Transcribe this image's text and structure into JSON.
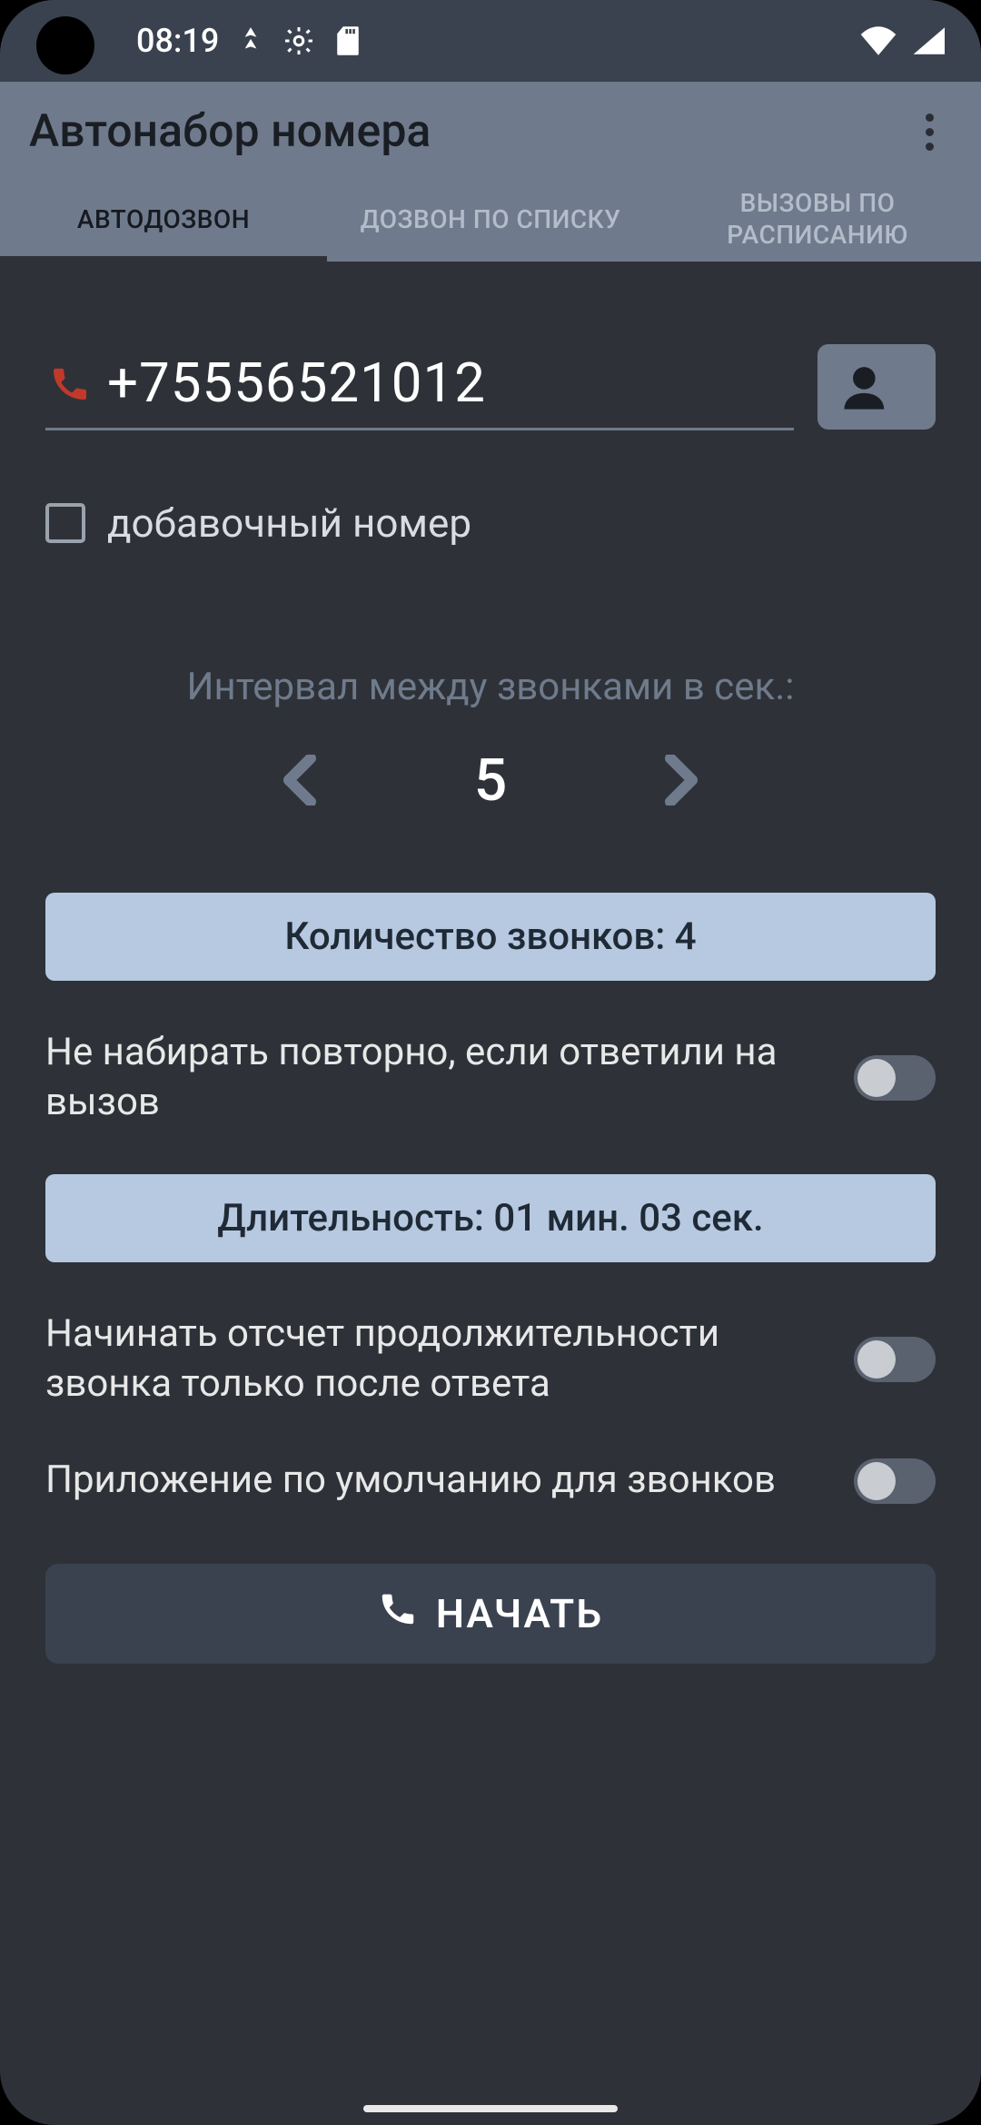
{
  "status": {
    "time": "08:19"
  },
  "appbar": {
    "title": "Автонабор номера"
  },
  "tabs": [
    {
      "label": "АВТОДОЗВОН"
    },
    {
      "label": "ДОЗВОН ПО СПИСКУ"
    },
    {
      "label": "ВЫЗОВЫ ПО РАСПИСАНИЮ"
    }
  ],
  "phone": {
    "value": "+75556521012"
  },
  "extension": {
    "label": "добавочный номер",
    "checked": false
  },
  "interval": {
    "label": "Интервал между звонками в сек.:",
    "value": "5"
  },
  "calls_count": {
    "label": "Количество звонков:  4"
  },
  "toggles": {
    "stop_on_answer": {
      "label": "Не набирать повторно, если ответили на вызов",
      "on": false
    },
    "count_after_answer": {
      "label": "Начинать отсчет продолжительности звонка только после ответа",
      "on": false
    },
    "default_dialer": {
      "label": "Приложение по умолчанию для звонков",
      "on": false
    }
  },
  "duration": {
    "label": "Длительность: 01 мин. 03 сек."
  },
  "start": {
    "label": "НАЧАТЬ"
  }
}
